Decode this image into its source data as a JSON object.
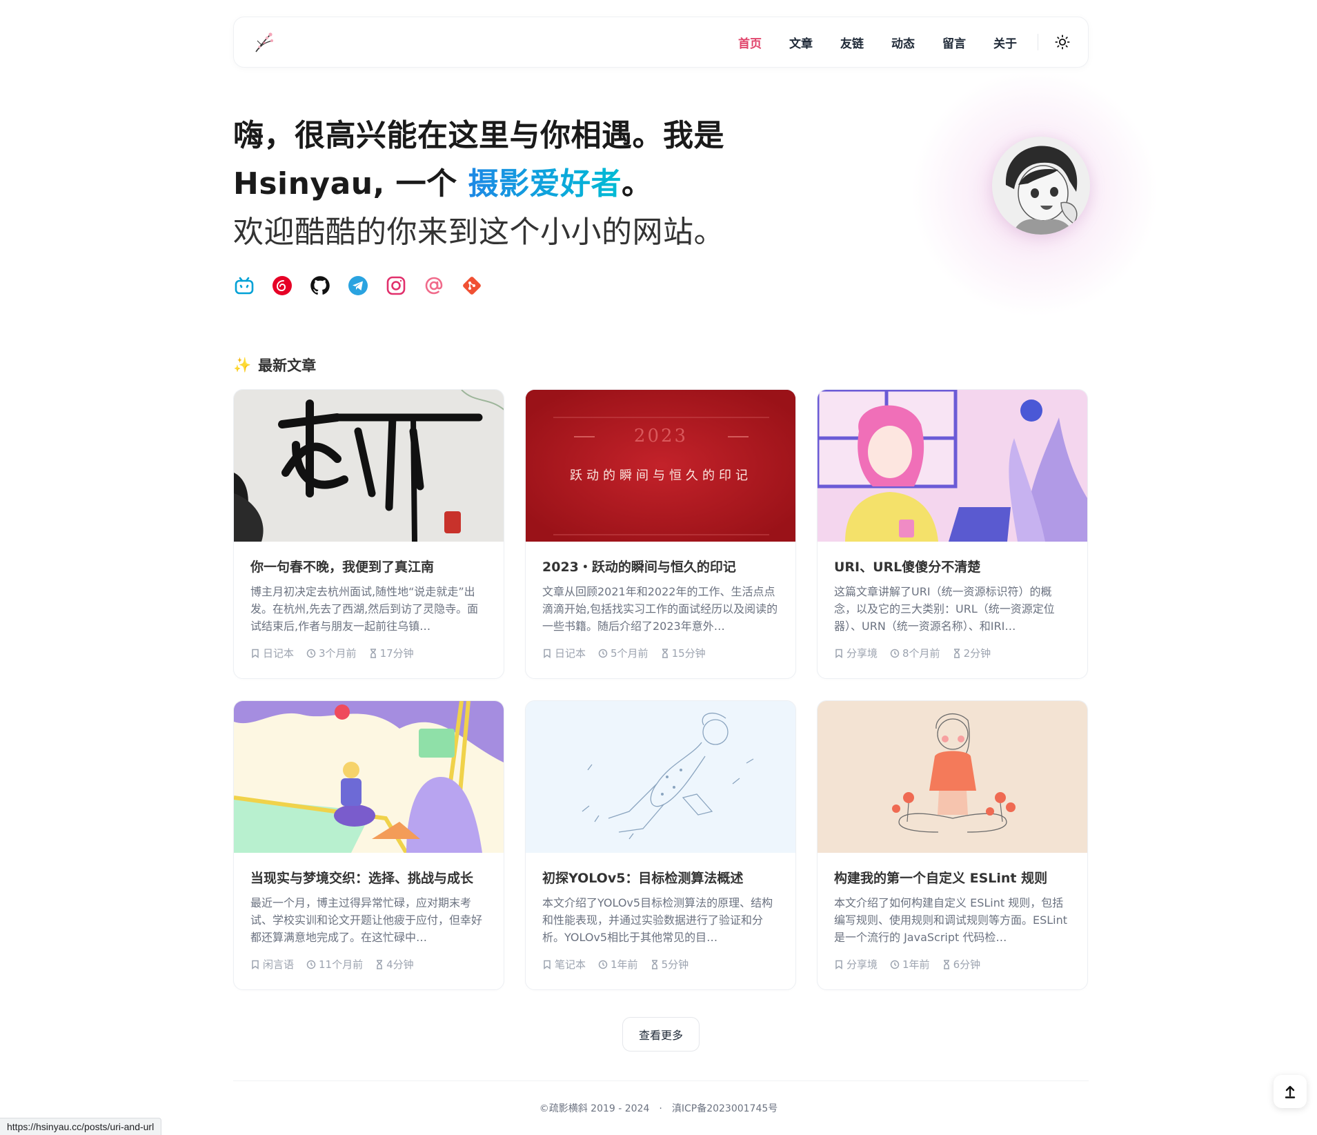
{
  "nav": {
    "items": [
      {
        "label": "首页",
        "active": true
      },
      {
        "label": "文章",
        "active": false
      },
      {
        "label": "友链",
        "active": false
      },
      {
        "label": "动态",
        "active": false
      },
      {
        "label": "留言",
        "active": false
      },
      {
        "label": "关于",
        "active": false
      }
    ],
    "theme_icon": "sun-icon"
  },
  "hero": {
    "line1": "嗨，很高兴能在这里与你相遇。我是",
    "line2_prefix": "Hsinyau, 一个 ",
    "line2_accent": "摄影爱好者",
    "line2_suffix": "。",
    "line3": "欢迎酷酷的你来到这个小小的网站。"
  },
  "socials": [
    {
      "name": "bilibili-icon",
      "color": "#00a1d6"
    },
    {
      "name": "netease-music-icon",
      "color": "#e60026"
    },
    {
      "name": "github-icon",
      "color": "#111111"
    },
    {
      "name": "telegram-icon",
      "color": "#2aa3e0"
    },
    {
      "name": "instagram-icon",
      "color": "#e1306c"
    },
    {
      "name": "email-icon",
      "color": "#f06a8a"
    },
    {
      "name": "git-icon",
      "color": "#f05033"
    }
  ],
  "section": {
    "icon": "✨",
    "title": "最新文章"
  },
  "posts": [
    {
      "title": "你一句春不晚，我便到了真江南",
      "desc": "博主月初决定去杭州面试,随性地“说走就走”出发。在杭州,先去了西湖,然后到访了灵隐寺。面试结束后,作者与朋友一起前往乌镇…",
      "category": "日记本",
      "time": "3个月前",
      "read": "17分钟"
    },
    {
      "title": "2023・跃动的瞬间与恒久的印记",
      "desc": "文章从回顾2021年和2022年的工作、生活点点滴滴开始,包括找实习工作的面试经历以及阅读的一些书籍。随后介绍了2023年意外…",
      "category": "日记本",
      "time": "5个月前",
      "read": "15分钟"
    },
    {
      "title": "URI、URL傻傻分不清楚",
      "desc": "这篇文章讲解了URI（统一资源标识符）的概念，以及它的三大类别：URL（统一资源定位器）、URN（统一资源名称）、和IRI…",
      "category": "分享境",
      "time": "8个月前",
      "read": "2分钟"
    },
    {
      "title": "当现实与梦境交织：选择、挑战与成长",
      "desc": "最近一个月，博主过得异常忙碌，应对期末考试、学校实训和论文开题让他疲于应付，但幸好都还算满意地完成了。在这忙碌中…",
      "category": "闲言语",
      "time": "11个月前",
      "read": "4分钟"
    },
    {
      "title": "初探YOLOv5：目标检测算法概述",
      "desc": "本文介绍了YOLOv5目标检测算法的原理、结构和性能表现，并通过实验数据进行了验证和分析。YOLOv5相比于其他常见的目…",
      "category": "笔记本",
      "time": "1年前",
      "read": "5分钟"
    },
    {
      "title": "构建我的第一个自定义 ESLint 规则",
      "desc": "本文介绍了如何构建自定义 ESLint 规则，包括编写规则、使用规则和调试规则等方面。ESLint 是一个流行的 JavaScript 代码检…",
      "category": "分享境",
      "time": "1年前",
      "read": "6分钟"
    }
  ],
  "cover2": {
    "year": "2023",
    "caption": "跃动的瞬间与恒久的印记"
  },
  "more_label": "查看更多",
  "footer": {
    "copyright": "©疏影横斜 2019 - 2024",
    "icp": "滇ICP备2023001745号"
  },
  "status_url": "https://hsinyau.cc/posts/uri-and-url",
  "colors": {
    "accent_nav": "#e0446b",
    "accent_from": "#1e88e5",
    "accent_to": "#00bcd4"
  }
}
